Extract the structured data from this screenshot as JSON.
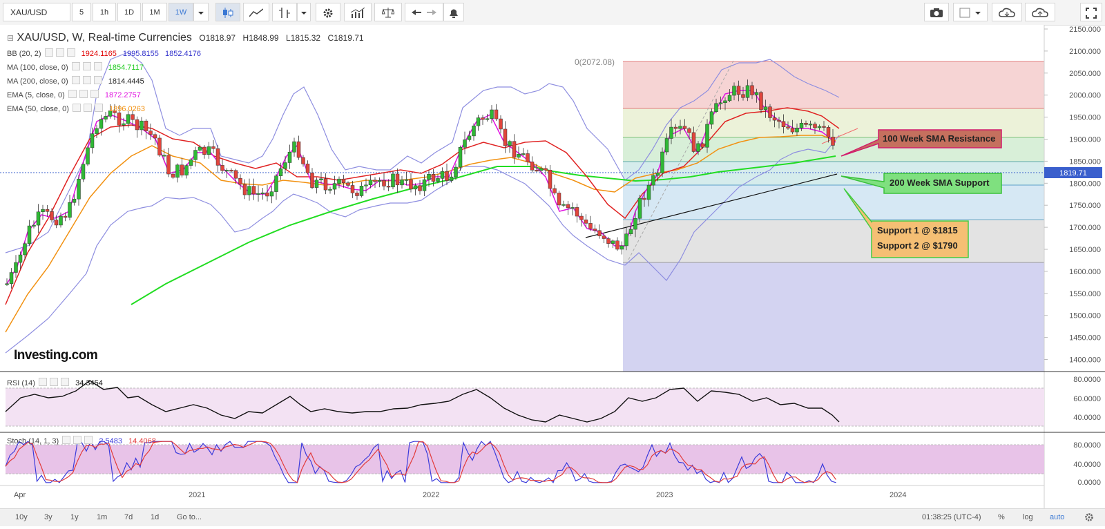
{
  "toolbar": {
    "symbol": "XAU/USD",
    "intervals": [
      "5",
      "1h",
      "1D",
      "1M",
      "1W"
    ],
    "active_interval": "1W"
  },
  "chart_header": {
    "title": "XAU/USD, W, Real-time Currencies",
    "open": "O1818.97",
    "high": "H1848.99",
    "low": "L1815.32",
    "close": "C1819.71"
  },
  "indicators": [
    {
      "name": "BB (20, 2)",
      "values": [
        "1924.1165",
        "1995.8155",
        "1852.4176"
      ],
      "colors": [
        "#e00000",
        "#3333cc",
        "#3333cc"
      ]
    },
    {
      "name": "MA (100, close, 0)",
      "values": [
        "1854.7117"
      ],
      "colors": [
        "#22cc22"
      ]
    },
    {
      "name": "MA (200, close, 0)",
      "values": [
        "1814.4445"
      ],
      "colors": [
        "#222222"
      ]
    },
    {
      "name": "EMA (5, close, 0)",
      "values": [
        "1872.2757"
      ],
      "colors": [
        "#e010e0"
      ]
    },
    {
      "name": "EMA (50, close, 0)",
      "values": [
        "1896.0263"
      ],
      "colors": [
        "#f29111"
      ]
    }
  ],
  "fib_label": "0(2072.08)",
  "price_axis": [
    "2150.000",
    "2100.000",
    "2050.000",
    "2000.000",
    "1950.000",
    "1900.000",
    "1850.000",
    "1800.000",
    "1750.000",
    "1700.000",
    "1650.000",
    "1600.000",
    "1550.000",
    "1500.000",
    "1450.000",
    "1400.000"
  ],
  "last_price": "1819.71",
  "rsi": {
    "label": "RSI (14)",
    "value": "34.3454",
    "axis": [
      "80.0000",
      "60.0000",
      "40.0000"
    ]
  },
  "stoch": {
    "label": "Stoch (14, 1, 3)",
    "k": "2.5483",
    "d": "14.4068",
    "axis": [
      "80.0000",
      "40.0000",
      "0.0000"
    ]
  },
  "time_axis": [
    "Apr",
    "2021",
    "2022",
    "2023",
    "2024"
  ],
  "annotations": {
    "resistance": "100 Week SMA Resistance",
    "support": "200 Week SMA Support",
    "support1": "Support 1 @ $1815",
    "support2": "Support 2 @ $1790"
  },
  "watermark": "Investing.com",
  "bottom_bar": {
    "ranges": [
      "10y",
      "3y",
      "1y",
      "1m",
      "7d",
      "1d"
    ],
    "goto": "Go to...",
    "time": "01:38:25 (UTC-4)",
    "percent": "%",
    "log": "log",
    "auto": "auto"
  },
  "colors": {
    "up": "#2fb835",
    "down": "#e0453c",
    "fib_top": "#f5d2d2",
    "fib_low": "#d4d4f2"
  }
}
